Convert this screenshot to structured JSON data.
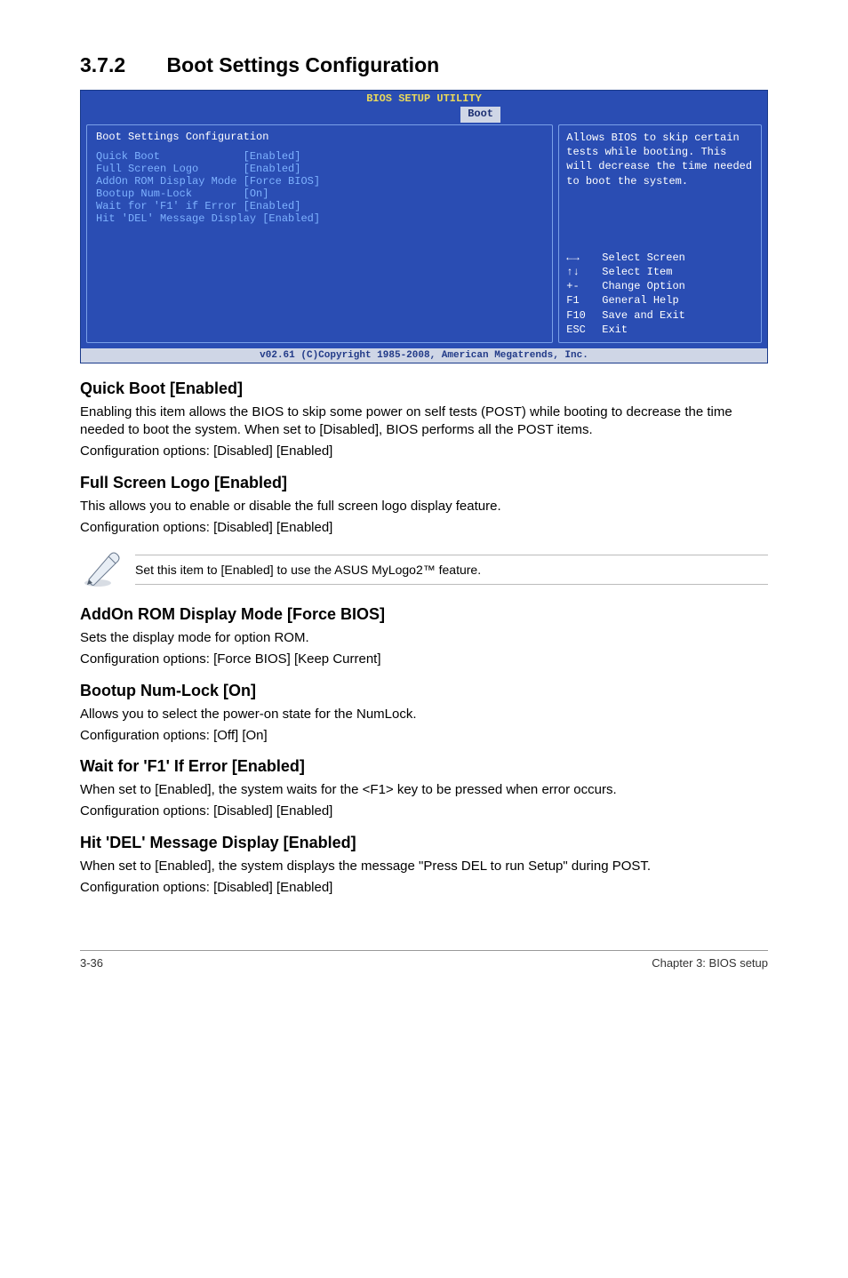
{
  "heading": {
    "number": "3.7.2",
    "title": "Boot Settings Configuration"
  },
  "bios": {
    "top_title": "BIOS SETUP UTILITY",
    "tab": "Boot",
    "config_title": "Boot Settings Configuration",
    "rows": [
      {
        "label": "Quick Boot",
        "value": "[Enabled]"
      },
      {
        "label": "Full Screen Logo",
        "value": "[Enabled]"
      },
      {
        "label": "AddOn ROM Display Mode",
        "value": "[Force BIOS]"
      },
      {
        "label": "Bootup Num-Lock",
        "value": "[On]"
      },
      {
        "label": "Wait for 'F1' if Error",
        "value": "[Enabled]"
      },
      {
        "label": "Hit 'DEL' Message Display",
        "value": "[Enabled]"
      }
    ],
    "help_text": "Allows BIOS to skip certain tests while booting. This will decrease the time needed to boot the system.",
    "keys": [
      {
        "sym": "←→",
        "desc": "Select Screen"
      },
      {
        "sym": "↑↓",
        "desc": "Select Item"
      },
      {
        "sym": "+-",
        "desc": "Change Option"
      },
      {
        "sym": "F1",
        "desc": "General Help"
      },
      {
        "sym": "F10",
        "desc": "Save and Exit"
      },
      {
        "sym": "ESC",
        "desc": "Exit"
      }
    ],
    "copyright": "v02.61 (C)Copyright 1985-2008, American Megatrends, Inc."
  },
  "sections": {
    "quickboot": {
      "title": "Quick Boot [Enabled]",
      "p1": "Enabling this item allows the BIOS to skip some power on self tests (POST) while booting to decrease the time needed to boot the system. When set to [Disabled], BIOS performs all the POST items.",
      "p2": "Configuration options: [Disabled] [Enabled]"
    },
    "fullscreen": {
      "title": "Full Screen Logo [Enabled]",
      "p1": "This allows you to enable or disable the full screen logo display feature.",
      "p2": "Configuration options: [Disabled] [Enabled]"
    },
    "note": "Set this item to [Enabled] to use the ASUS MyLogo2™ feature.",
    "addon": {
      "title": "AddOn ROM Display Mode [Force BIOS]",
      "p1": "Sets the display mode for option ROM.",
      "p2": "Configuration options: [Force BIOS] [Keep Current]"
    },
    "numlock": {
      "title": "Bootup Num-Lock [On]",
      "p1": "Allows you to select the power-on state for the NumLock.",
      "p2": "Configuration options: [Off] [On]"
    },
    "waitf1": {
      "title": "Wait for 'F1' If Error [Enabled]",
      "p1": "When set to [Enabled], the system waits for the <F1> key to be pressed when error occurs.",
      "p2": "Configuration options: [Disabled] [Enabled]"
    },
    "hitdel": {
      "title": "Hit 'DEL' Message Display [Enabled]",
      "p1": "When set to [Enabled], the system displays the message \"Press DEL to run Setup\" during POST.",
      "p2": "Configuration options: [Disabled] [Enabled]"
    }
  },
  "footer": {
    "left": "3-36",
    "right": "Chapter 3: BIOS setup"
  }
}
